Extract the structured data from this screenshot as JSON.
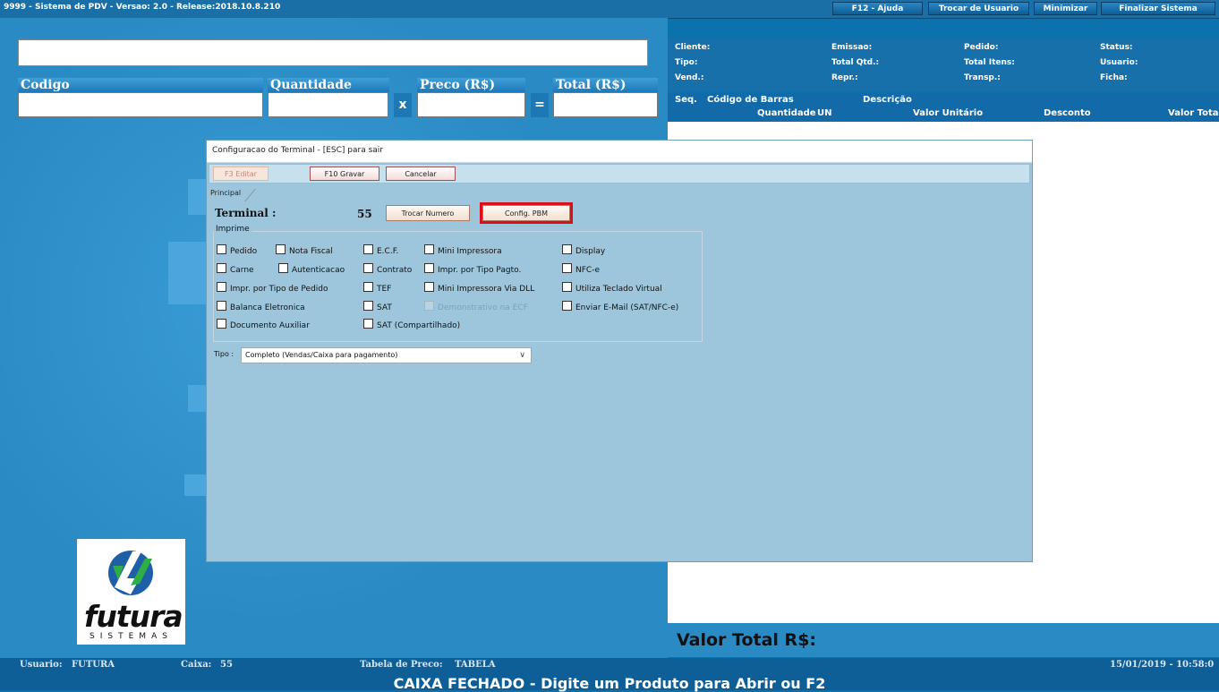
{
  "window": {
    "title": "9999 - Sistema de PDV - Versao: 2.0 - Release:2018.10.8.210",
    "buttons": [
      "F12 - Ajuda",
      "Trocar de Usuario",
      "Minimizar",
      "Finalizar Sistema"
    ]
  },
  "entry": {
    "codigo_label": "Codigo",
    "quantidade_label": "Quantidade",
    "preco_label": "Preco (R$)",
    "total_label": "Total (R$)",
    "times_sign": "x",
    "equals_sign": "="
  },
  "order_header": {
    "cliente": "Cliente:",
    "tipo": "Tipo:",
    "vend": "Vend.:",
    "emissao": "Emissao:",
    "total_qtd": "Total Qtd.:",
    "repr": "Repr.:",
    "pedido": "Pedido:",
    "total_itens": "Total Itens:",
    "transp": "Transp.:",
    "status": "Status:",
    "usuario": "Usuario:",
    "ficha": "Ficha:"
  },
  "grid": {
    "seq": "Seq.",
    "codigo_barras": "Código de Barras",
    "descricao": "Descrição",
    "quantidade": "Quantidade",
    "un": "UN",
    "valor_unitario": "Valor Unitário",
    "desconto": "Desconto",
    "valor_total": "Valor Total"
  },
  "valor_total_label": "Valor Total R$:",
  "status_bar": {
    "usuario_label": "Usuario:",
    "usuario_value": "FUTURA",
    "caixa_label": "Caixa:",
    "caixa_value": "55",
    "tabela_label": "Tabela de Preco:",
    "tabela_value": "TABELA",
    "datetime": "15/01/2019 - 10:58:0",
    "message": "CAIXA FECHADO - Digite um Produto para Abrir ou F2"
  },
  "logo": {
    "text": "futura",
    "subtext": "SISTEMAS"
  },
  "dialog": {
    "title": "Configuracao do Terminal - [ESC] para sair",
    "toolbar": {
      "edit": "F3 Editar",
      "save": "F10 Gravar",
      "cancel": "Cancelar"
    },
    "tab": "Principal",
    "terminal_label": "Terminal :",
    "terminal_number": "55",
    "trocar_numero": "Trocar Numero",
    "config_pbm": "Config. PBM",
    "imprime_legend": "Imprime",
    "checkboxes": {
      "pedido": "Pedido",
      "nota_fiscal": "Nota Fiscal",
      "ecf": "E.C.F.",
      "mini_impressora": "Mini Impressora",
      "display": "Display",
      "carne": "Carne",
      "autenticacao": "Autenticacao",
      "contrato": "Contrato",
      "impr_tipo_pagto": "Impr. por Tipo Pagto.",
      "nfce": "NFC-e",
      "impr_tipo_pedido": "Impr. por Tipo de Pedido",
      "tef": "TEF",
      "mini_impressora_dll": "Mini Impressora Via DLL",
      "teclado_virtual": "Utiliza Teclado Virtual",
      "balanca": "Balanca Eletronica",
      "sat": "SAT",
      "demonstrativo_ecf": "Demonstrativo na ECF",
      "enviar_email": "Enviar E-Mail (SAT/NFC-e)",
      "documento_auxiliar": "Documento Auxiliar",
      "sat_compartilhado": "SAT (Compartilhado)"
    },
    "tipo_label": "Tipo :",
    "tipo_value": "Completo (Vendas/Caixa para pagamento)"
  }
}
